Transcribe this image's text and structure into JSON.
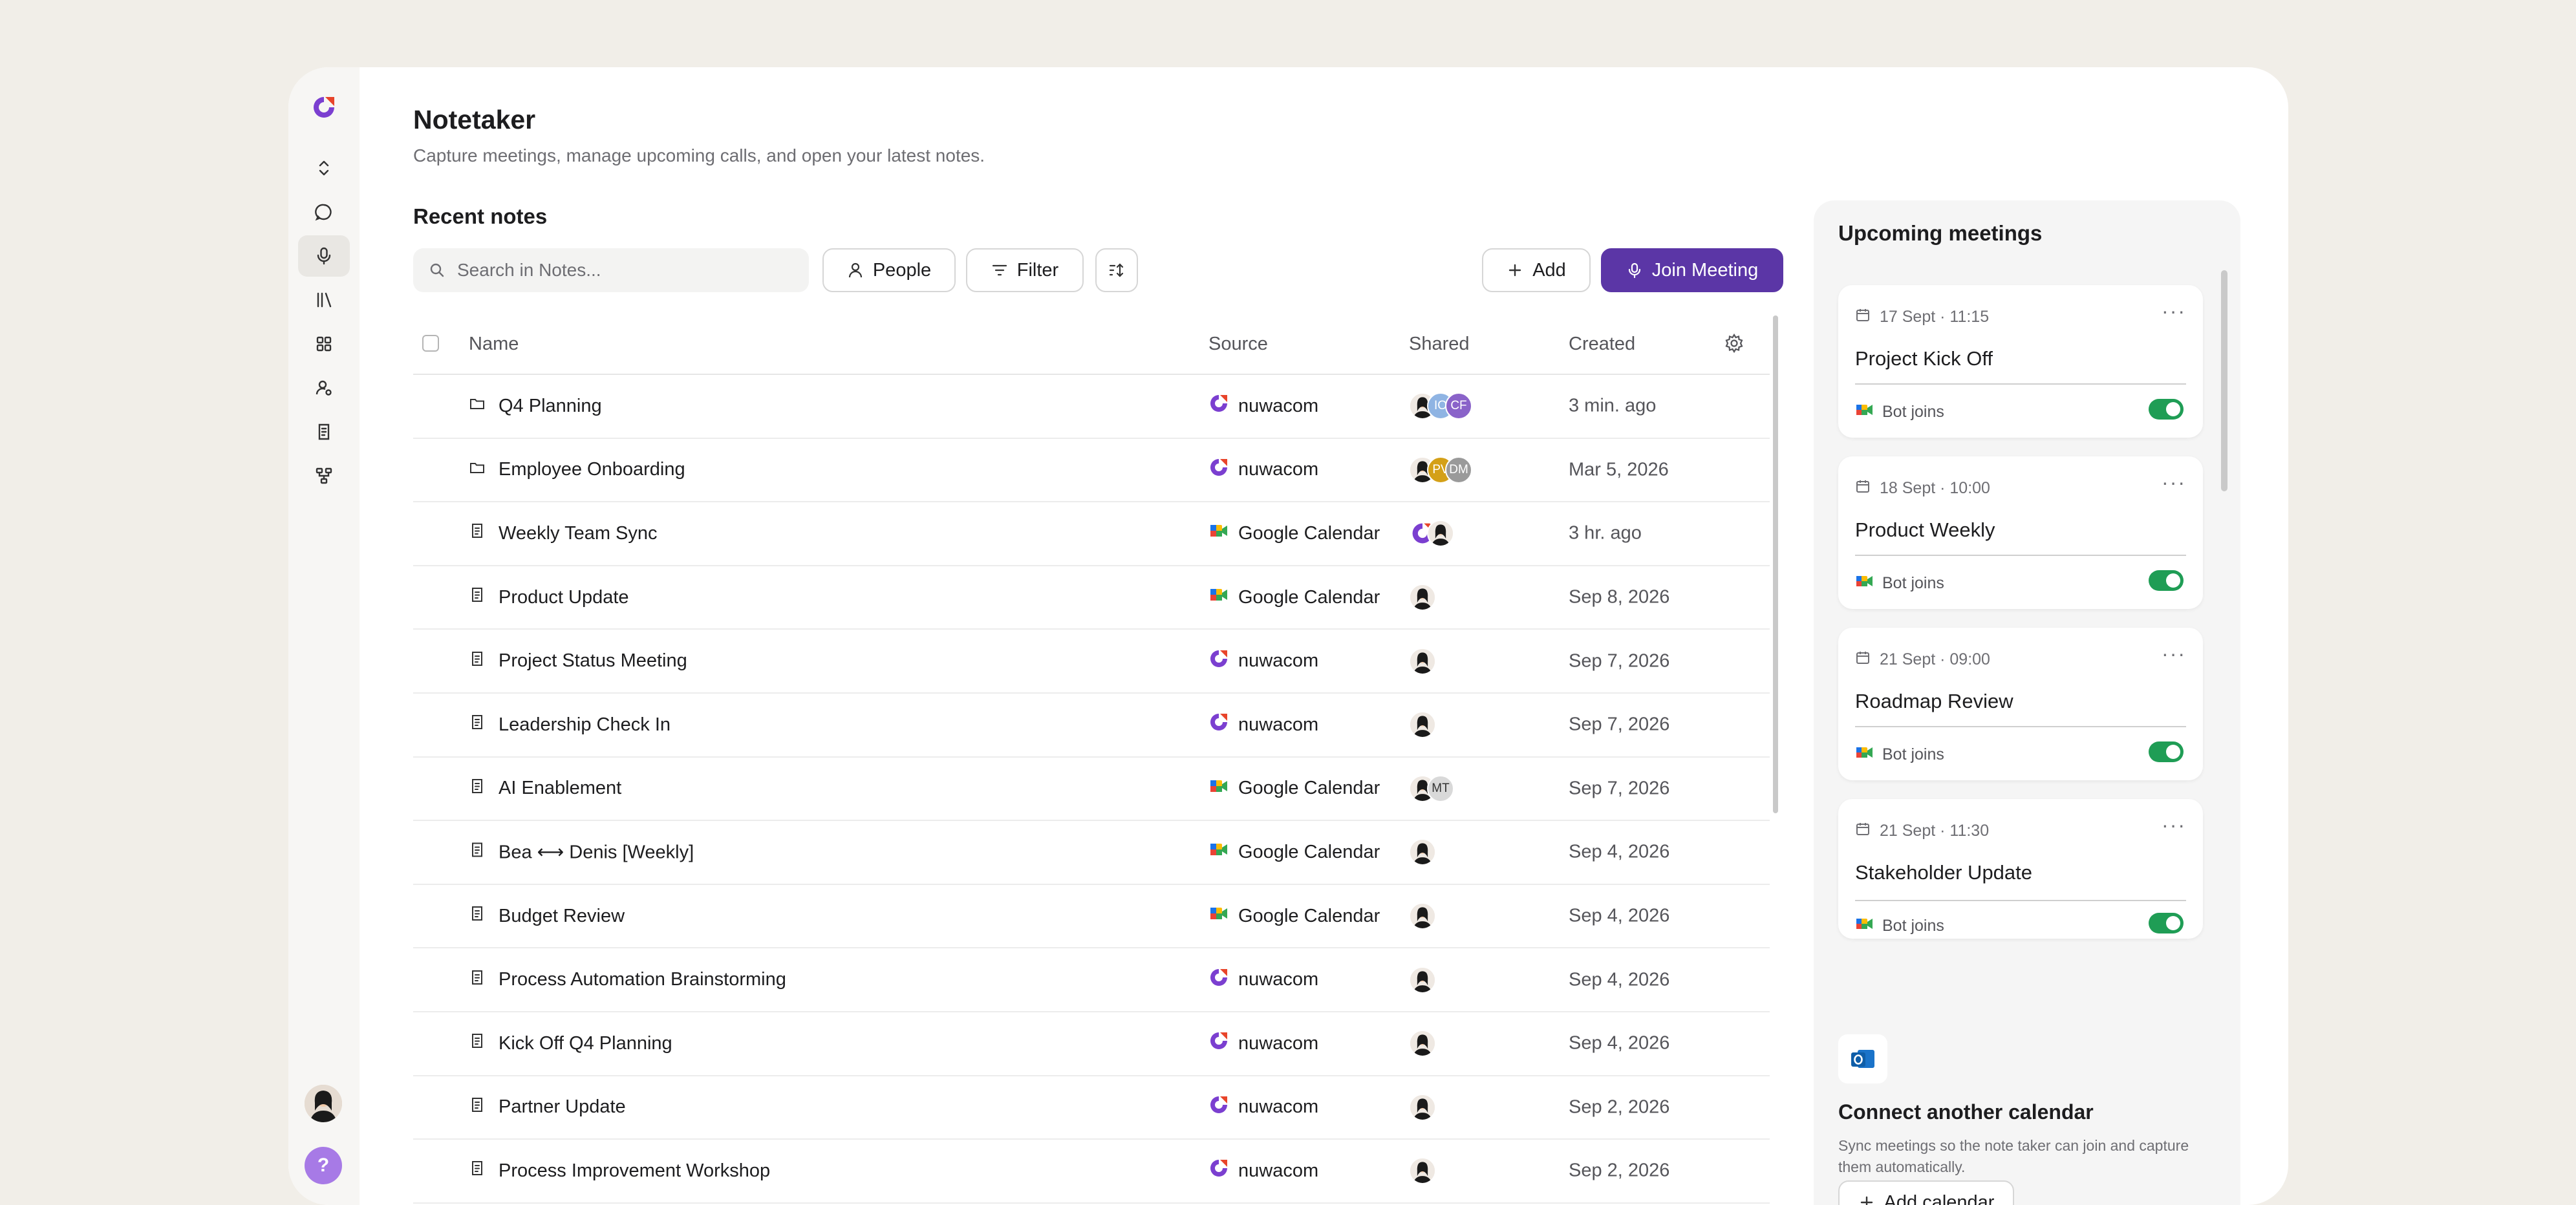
{
  "header": {
    "title": "Notetaker",
    "subtitle": "Capture meetings, manage upcoming calls, and open your latest notes."
  },
  "recent": {
    "title": "Recent notes",
    "search_placeholder": "Search in Notes...",
    "people_label": "People",
    "filter_label": "Filter",
    "add_label": "Add",
    "join_label": "Join Meeting"
  },
  "table": {
    "headers": {
      "name": "Name",
      "source": "Source",
      "shared": "Shared",
      "created": "Created"
    },
    "rows": [
      {
        "name": "Q4 Planning",
        "kind": "folder",
        "source": "nuwacom",
        "shared": [
          "person",
          "IO",
          "CF"
        ],
        "created": "3 min. ago"
      },
      {
        "name": "Employee Onboarding",
        "kind": "folder",
        "source": "nuwacom",
        "shared": [
          "person",
          "PV",
          "DM"
        ],
        "created": "Mar 5, 2026"
      },
      {
        "name": "Weekly Team Sync",
        "kind": "note",
        "source": "Google Calendar",
        "shared": [
          "nuwacom",
          "person"
        ],
        "created": "3 hr. ago"
      },
      {
        "name": "Product Update",
        "kind": "note",
        "source": "Google Calendar",
        "shared": [
          "person"
        ],
        "created": "Sep 8, 2026"
      },
      {
        "name": "Project Status Meeting",
        "kind": "note",
        "source": "nuwacom",
        "shared": [
          "person"
        ],
        "created": "Sep 7, 2026"
      },
      {
        "name": "Leadership Check In",
        "kind": "note",
        "source": "nuwacom",
        "shared": [
          "person"
        ],
        "created": "Sep 7, 2026"
      },
      {
        "name": "AI Enablement",
        "kind": "note",
        "source": "Google Calendar",
        "shared": [
          "person",
          "MT"
        ],
        "created": "Sep 7, 2026"
      },
      {
        "name": "Bea ⟷ Denis [Weekly]",
        "kind": "note",
        "source": "Google Calendar",
        "shared": [
          "person"
        ],
        "created": "Sep 4, 2026"
      },
      {
        "name": "Budget Review",
        "kind": "note",
        "source": "Google Calendar",
        "shared": [
          "person"
        ],
        "created": "Sep 4, 2026"
      },
      {
        "name": "Process Automation Brainstorming",
        "kind": "note",
        "source": "nuwacom",
        "shared": [
          "person"
        ],
        "created": "Sep 4, 2026"
      },
      {
        "name": "Kick Off Q4 Planning",
        "kind": "note",
        "source": "nuwacom",
        "shared": [
          "person"
        ],
        "created": "Sep 4, 2026"
      },
      {
        "name": "Partner Update",
        "kind": "note",
        "source": "nuwacom",
        "shared": [
          "person"
        ],
        "created": "Sep 2, 2026"
      },
      {
        "name": "Process Improvement Workshop",
        "kind": "note",
        "source": "nuwacom",
        "shared": [
          "person"
        ],
        "created": "Sep 2, 2026"
      }
    ]
  },
  "upcoming": {
    "title": "Upcoming meetings",
    "meetings": [
      {
        "when": "17 Sept · 11:15",
        "name": "Project Kick Off",
        "bot": "Bot joins",
        "enabled": true
      },
      {
        "when": "18 Sept · 10:00",
        "name": "Product Weekly",
        "bot": "Bot joins",
        "enabled": true
      },
      {
        "when": "21 Sept · 09:00",
        "name": "Roadmap Review",
        "bot": "Bot joins",
        "enabled": true
      },
      {
        "when": "21 Sept · 11:30",
        "name": "Stakeholder Update",
        "bot": "Bot joins",
        "enabled": true
      }
    ],
    "connect_title": "Connect another calendar",
    "connect_text": "Sync meetings so the note taker can join and capture them automatically.",
    "add_calendar_label": "Add calendar"
  },
  "colors": {
    "accent": "#5b36a6",
    "toggle_on": "#1f9d55",
    "background": "#f1eee8"
  },
  "sidebar_icons": [
    "nuwacom-logo-icon",
    "expand-collapse-icon",
    "chat-icon",
    "microphone-icon",
    "library-icon",
    "apps-grid-icon",
    "user-settings-icon",
    "document-icon",
    "workflow-icon"
  ]
}
